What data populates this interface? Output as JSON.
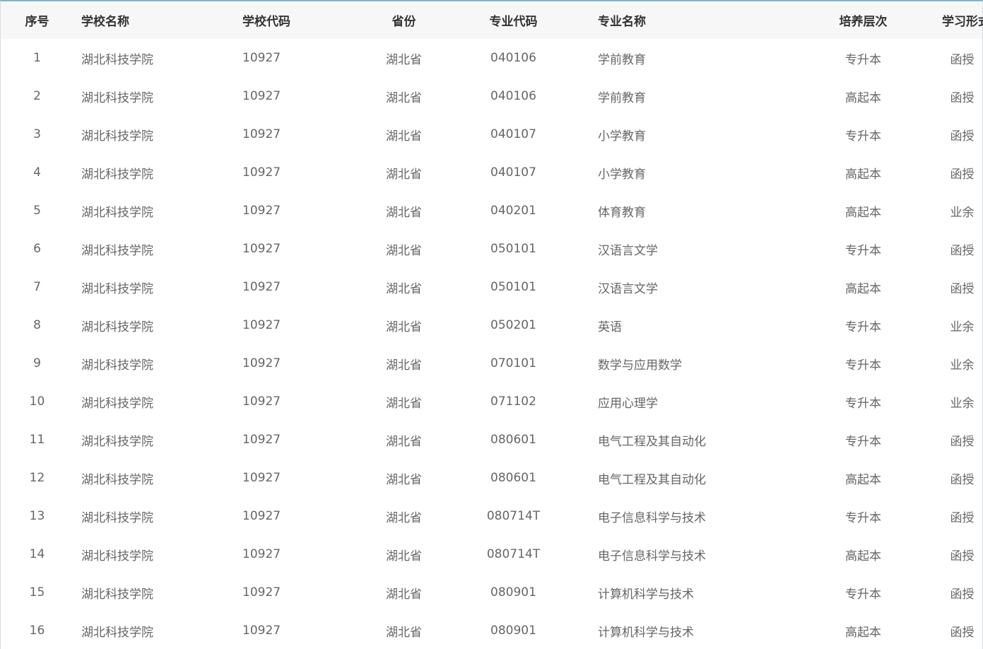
{
  "table": {
    "headers": {
      "index": "序号",
      "school_name": "学校名称",
      "school_code": "学校代码",
      "province": "省份",
      "major_code": "专业代码",
      "major_name": "专业名称",
      "level": "培养层次",
      "study_mode": "学习形式"
    },
    "rows": [
      {
        "index": "1",
        "school_name": "湖北科技学院",
        "school_code": "10927",
        "province": "湖北省",
        "major_code": "040106",
        "major_name": "学前教育",
        "level": "专升本",
        "study_mode": "函授"
      },
      {
        "index": "2",
        "school_name": "湖北科技学院",
        "school_code": "10927",
        "province": "湖北省",
        "major_code": "040106",
        "major_name": "学前教育",
        "level": "高起本",
        "study_mode": "函授"
      },
      {
        "index": "3",
        "school_name": "湖北科技学院",
        "school_code": "10927",
        "province": "湖北省",
        "major_code": "040107",
        "major_name": "小学教育",
        "level": "专升本",
        "study_mode": "函授"
      },
      {
        "index": "4",
        "school_name": "湖北科技学院",
        "school_code": "10927",
        "province": "湖北省",
        "major_code": "040107",
        "major_name": "小学教育",
        "level": "高起本",
        "study_mode": "函授"
      },
      {
        "index": "5",
        "school_name": "湖北科技学院",
        "school_code": "10927",
        "province": "湖北省",
        "major_code": "040201",
        "major_name": "体育教育",
        "level": "高起本",
        "study_mode": "业余"
      },
      {
        "index": "6",
        "school_name": "湖北科技学院",
        "school_code": "10927",
        "province": "湖北省",
        "major_code": "050101",
        "major_name": "汉语言文学",
        "level": "专升本",
        "study_mode": "函授"
      },
      {
        "index": "7",
        "school_name": "湖北科技学院",
        "school_code": "10927",
        "province": "湖北省",
        "major_code": "050101",
        "major_name": "汉语言文学",
        "level": "高起本",
        "study_mode": "函授"
      },
      {
        "index": "8",
        "school_name": "湖北科技学院",
        "school_code": "10927",
        "province": "湖北省",
        "major_code": "050201",
        "major_name": "英语",
        "level": "专升本",
        "study_mode": "业余"
      },
      {
        "index": "9",
        "school_name": "湖北科技学院",
        "school_code": "10927",
        "province": "湖北省",
        "major_code": "070101",
        "major_name": "数学与应用数学",
        "level": "专升本",
        "study_mode": "业余"
      },
      {
        "index": "10",
        "school_name": "湖北科技学院",
        "school_code": "10927",
        "province": "湖北省",
        "major_code": "071102",
        "major_name": "应用心理学",
        "level": "专升本",
        "study_mode": "业余"
      },
      {
        "index": "11",
        "school_name": "湖北科技学院",
        "school_code": "10927",
        "province": "湖北省",
        "major_code": "080601",
        "major_name": "电气工程及其自动化",
        "level": "专升本",
        "study_mode": "函授"
      },
      {
        "index": "12",
        "school_name": "湖北科技学院",
        "school_code": "10927",
        "province": "湖北省",
        "major_code": "080601",
        "major_name": "电气工程及其自动化",
        "level": "高起本",
        "study_mode": "函授"
      },
      {
        "index": "13",
        "school_name": "湖北科技学院",
        "school_code": "10927",
        "province": "湖北省",
        "major_code": "080714T",
        "major_name": "电子信息科学与技术",
        "level": "专升本",
        "study_mode": "函授"
      },
      {
        "index": "14",
        "school_name": "湖北科技学院",
        "school_code": "10927",
        "province": "湖北省",
        "major_code": "080714T",
        "major_name": "电子信息科学与技术",
        "level": "高起本",
        "study_mode": "函授"
      },
      {
        "index": "15",
        "school_name": "湖北科技学院",
        "school_code": "10927",
        "province": "湖北省",
        "major_code": "080901",
        "major_name": "计算机科学与技术",
        "level": "专升本",
        "study_mode": "函授"
      },
      {
        "index": "16",
        "school_name": "湖北科技学院",
        "school_code": "10927",
        "province": "湖北省",
        "major_code": "080901",
        "major_name": "计算机科学与技术",
        "level": "高起本",
        "study_mode": "函授"
      }
    ]
  }
}
